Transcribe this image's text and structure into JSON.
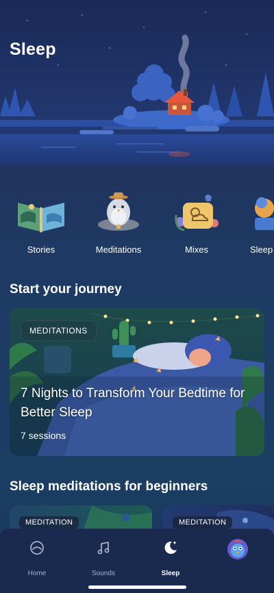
{
  "header": {
    "title": "Sleep"
  },
  "categories": [
    {
      "label": "Stories",
      "icon": "open-book-icon"
    },
    {
      "label": "Meditations",
      "icon": "meditating-bird-icon"
    },
    {
      "label": "Mixes",
      "icon": "weather-cloud-icon"
    },
    {
      "label": "Sleep",
      "icon": "sleep-character-icon"
    }
  ],
  "journey": {
    "section_title": "Start your journey",
    "card": {
      "tag": "MEDITATIONS",
      "title": "7 Nights to Transform Your Bedtime for Better Sleep",
      "subtitle": "7 sessions"
    }
  },
  "beginners": {
    "section_title": "Sleep meditations for beginners",
    "cards": [
      {
        "tag": "MEDITATION"
      },
      {
        "tag": "MEDITATION"
      }
    ]
  },
  "nav": {
    "items": [
      {
        "label": "Home",
        "icon": "home-dial-icon",
        "active": false
      },
      {
        "label": "Sounds",
        "icon": "music-note-icon",
        "active": false
      },
      {
        "label": "Sleep",
        "icon": "moon-stars-icon",
        "active": true
      },
      {
        "label": "",
        "icon": "avatar-icon",
        "active": false
      }
    ]
  },
  "colors": {
    "background": "#20335d",
    "nav_background": "#1a2a4f",
    "text": "#ffffff",
    "muted_text": "#a7b0c8",
    "accent_house": "#e8573c"
  }
}
